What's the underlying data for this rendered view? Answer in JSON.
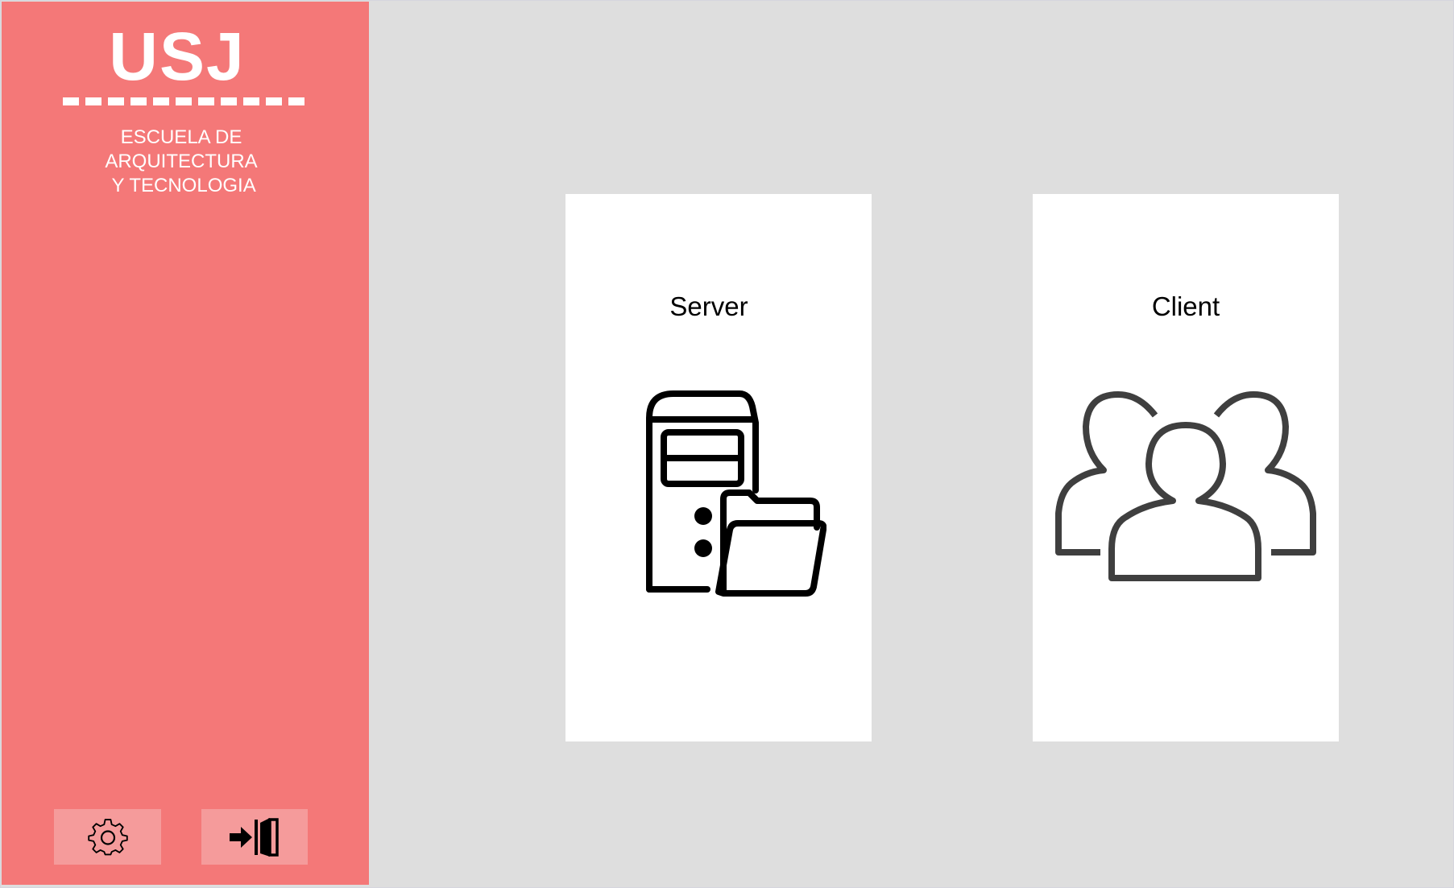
{
  "sidebar": {
    "logo_title": "USJ",
    "logo_subtitle": "ESCUELA DE\nARQUITECTURA\n Y TECNOLOGIA",
    "settings_icon": "gear-icon",
    "exit_icon": "door-enter-icon"
  },
  "main": {
    "cards": [
      {
        "label": "Server",
        "icon": "server-folder-icon"
      },
      {
        "label": "Client",
        "icon": "users-group-icon"
      }
    ]
  },
  "colors": {
    "sidebar_bg": "#f47878",
    "sidebar_button_bg": "#f59b9b",
    "main_bg": "#dedede",
    "card_bg": "#ffffff"
  }
}
